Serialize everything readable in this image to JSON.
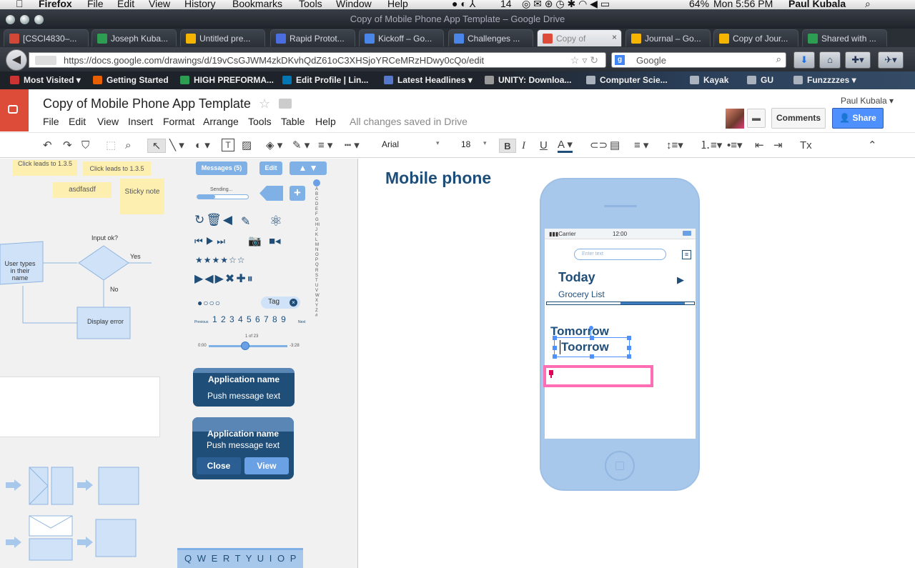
{
  "menubar": {
    "app": "Firefox",
    "menus": [
      "File",
      "Edit",
      "View",
      "History",
      "Bookmarks",
      "Tools",
      "Window",
      "Help"
    ],
    "status": {
      "badge": "14",
      "battery": "64%",
      "clock": "Mon 5:56 PM",
      "user": "Paul Kubala"
    }
  },
  "window": {
    "title": "Copy of Mobile Phone App Template – Google Drive"
  },
  "tabs": [
    {
      "label": "[CSCI4830–...",
      "favicon": "gmail-icon",
      "color": "#d14836"
    },
    {
      "label": "Joseph Kuba...",
      "favicon": "drive-icon",
      "color": "#2d9d51"
    },
    {
      "label": "Untitled pre...",
      "favicon": "slides-icon",
      "color": "#f4b400"
    },
    {
      "label": "Rapid Protot...",
      "favicon": "forms-icon",
      "color": "#4a6ee0"
    },
    {
      "label": "Kickoff – Go...",
      "favicon": "docs-icon",
      "color": "#4a86e8"
    },
    {
      "label": "Challenges ...",
      "favicon": "docs-icon",
      "color": "#4a86e8"
    },
    {
      "label": "Copy of",
      "favicon": "drawings-icon",
      "color": "#dd4b39",
      "active": true
    },
    {
      "label": "Journal – Go...",
      "favicon": "slides-icon",
      "color": "#f4b400"
    },
    {
      "label": "Copy of Jour...",
      "favicon": "slides-icon",
      "color": "#f4b400"
    },
    {
      "label": "Shared with ...",
      "favicon": "drive-icon",
      "color": "#2d9d51"
    }
  ],
  "nav": {
    "url": "https://docs.google.com/drawings/d/19vCsGJWM4zkDKvhQdZ61oC3XHSjoYRCeMRzHDwy0cQo/edit",
    "search_placeholder": "Google"
  },
  "bookmarks": [
    {
      "label": "Most Visited ▾",
      "color": "#c33"
    },
    {
      "label": "Getting Started",
      "color": "#e66000"
    },
    {
      "label": "HIGH PREFORMA...",
      "color": "#2d9d51"
    },
    {
      "label": "Edit Profile | Lin...",
      "color": "#0077b5"
    },
    {
      "label": "Latest Headlines ▾",
      "color": "#5577cc"
    },
    {
      "label": "UNITY: Downloa...",
      "color": "#999"
    },
    {
      "label": "Computer Scie...",
      "color": "#aab3bd"
    },
    {
      "label": "Kayak",
      "color": "#aab3bd"
    },
    {
      "label": "GU",
      "color": "#aab3bd"
    },
    {
      "label": "Funzzzzes ▾",
      "color": "#aab3bd"
    }
  ],
  "doc": {
    "title": "Copy of Mobile Phone App Template",
    "menus": [
      "File",
      "Edit",
      "View",
      "Insert",
      "Format",
      "Arrange",
      "Tools",
      "Table",
      "Help"
    ],
    "saved": "All changes saved in Drive",
    "user": "Paul Kubala",
    "comments": "Comments",
    "share": "Share",
    "font": "Arial",
    "font_size": "18"
  },
  "pane": {
    "sticky1": "Click leads to 1.3.5",
    "sticky2": "Click leads to 1.3.5",
    "sticky3": "asdfasdf",
    "sticky4": "Sticky note",
    "flow": {
      "input": "User types in their name",
      "decision": "Input ok?",
      "yes": "Yes",
      "no": "No",
      "error": "Display error"
    },
    "messages": "Messages (5)",
    "edit": "Edit",
    "sending": "Sending...",
    "alphabet": "ABCDEFGHIJKLMNOPQRSTUVWXYZ#",
    "stars": "★★★★☆☆",
    "tag": "Tag",
    "pager": {
      "prev": "Previous",
      "next": "Next",
      "pages": "1 2 3 4 5 6 7 8 9"
    },
    "scrubber": {
      "count": "1 of 23",
      "start": "0:00",
      "end": "-3:28"
    },
    "push1": {
      "app": "Application name",
      "msg": "Push message text"
    },
    "push2": {
      "app": "Application name",
      "msg": "Push message text",
      "close": "Close",
      "view": "View"
    },
    "keyboard": "Q W E R T Y U I O P"
  },
  "canvas": {
    "heading": "Mobile phone",
    "phone": {
      "carrier": "Carrier",
      "time": "12:00",
      "search_placeholder": "Enter text",
      "today": "Today",
      "subtitle": "Grocery List",
      "tomorrow": "Tomorrow",
      "edited": "Toorrow"
    }
  },
  "colors": {
    "accent": "#4d90fe",
    "docs_red": "#dd4b39",
    "wire": "#a8c8eb",
    "wire_dark": "#1f4e79",
    "selection": "#ff6eb4"
  }
}
